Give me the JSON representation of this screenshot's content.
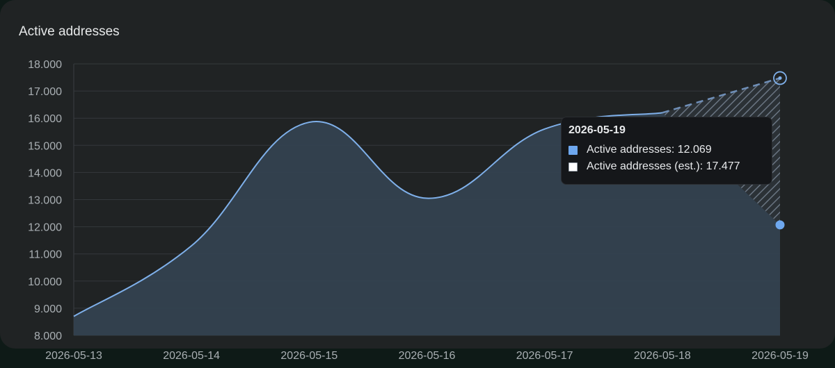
{
  "card": {
    "title": "Active addresses"
  },
  "tooltip": {
    "title": "2026-05-19",
    "rows": [
      {
        "label": "Active addresses: 12.069",
        "color": "#6ea8ef"
      },
      {
        "label": "Active addresses (est.): 17.477",
        "color": "#ffffff"
      }
    ]
  },
  "chart_data": {
    "type": "area",
    "title": "Active addresses",
    "x": [
      "2026-05-13",
      "2026-05-14",
      "2026-05-15",
      "2026-05-16",
      "2026-05-17",
      "2026-05-18",
      "2026-05-19"
    ],
    "ylim": [
      8000,
      18000
    ],
    "y_ticks": [
      "8.000",
      "9.000",
      "10.000",
      "11.000",
      "12.000",
      "13.000",
      "14.000",
      "15.000",
      "16.000",
      "17.000",
      "18.000"
    ],
    "series": [
      {
        "name": "Active addresses",
        "values": [
          8700,
          11300,
          15850,
          13050,
          15600,
          16200,
          12069
        ],
        "color": "#7fb0ea"
      },
      {
        "name": "Active addresses (est.)",
        "values": [
          null,
          null,
          null,
          null,
          null,
          16200,
          17477
        ],
        "style": "dashed-hatched",
        "color": "#6f8fb8"
      }
    ],
    "grid": true,
    "legend": "none"
  }
}
